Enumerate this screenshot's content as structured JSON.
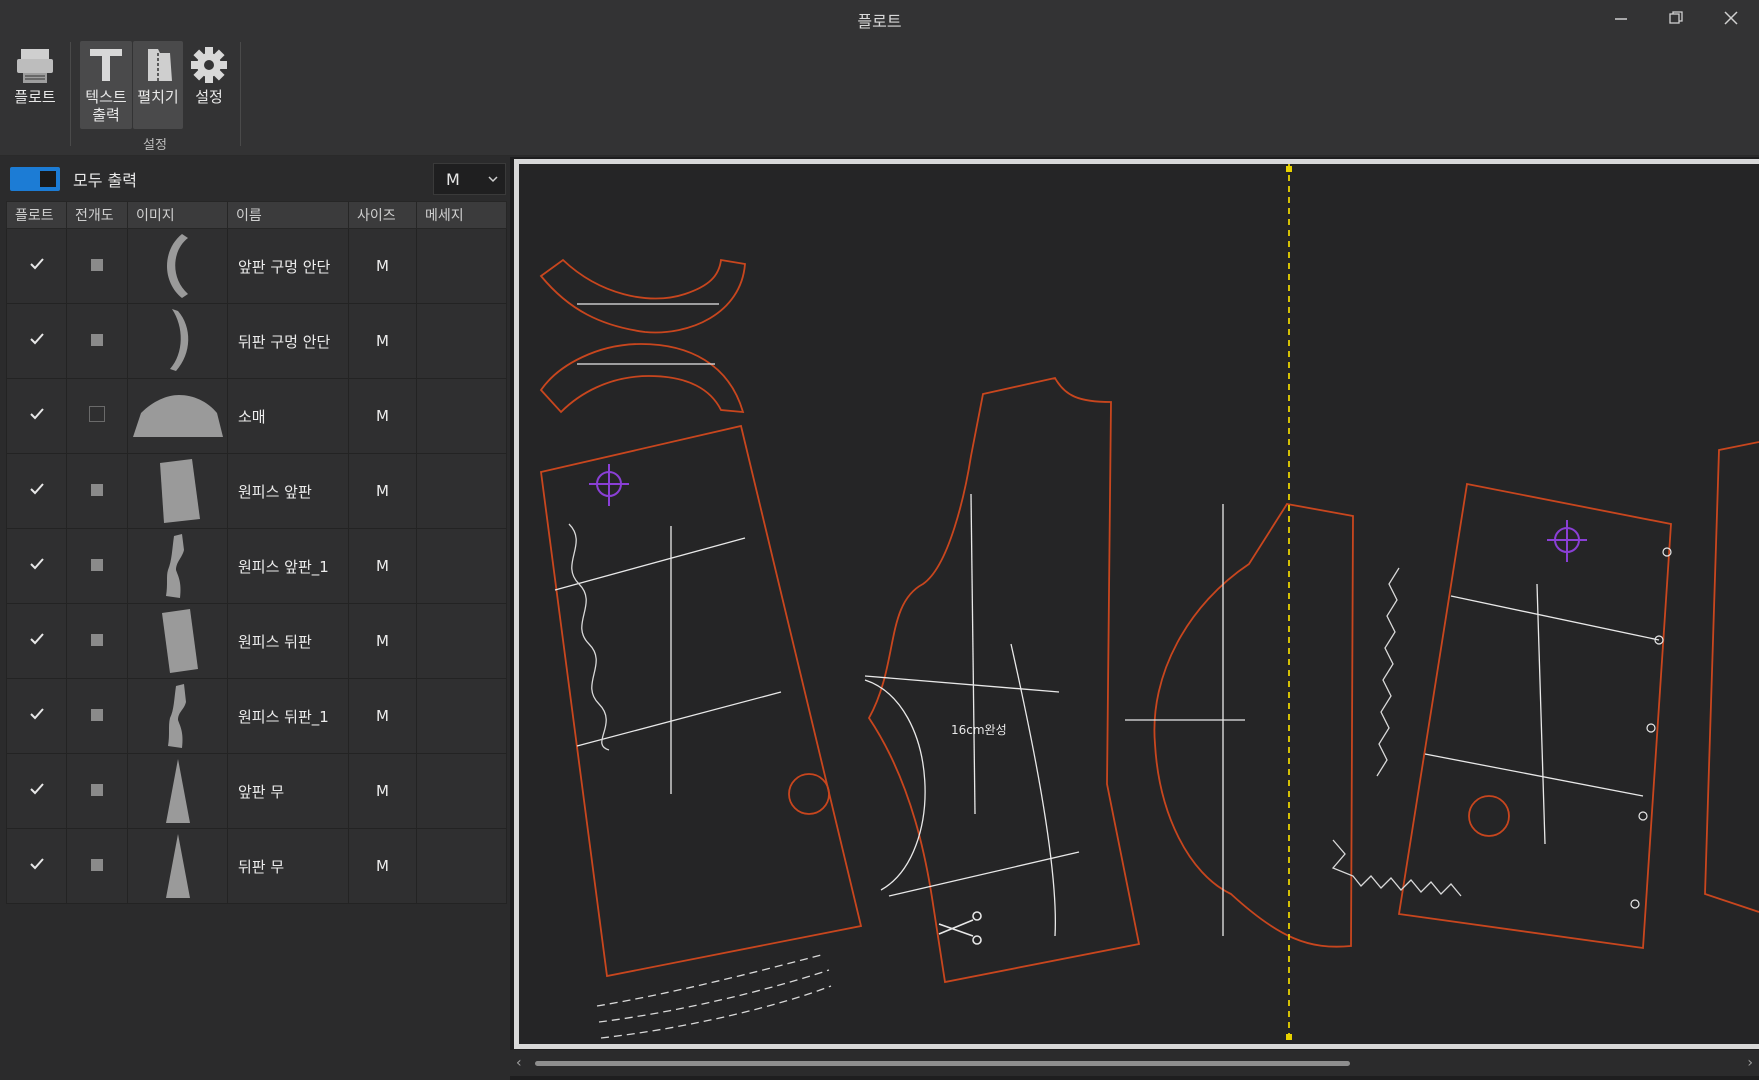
{
  "window": {
    "title": "플로트"
  },
  "ribbon": {
    "plot_label": "플로트",
    "text_output_label_line1": "텍스트",
    "text_output_label_line2": "출력",
    "unfold_label": "펼치기",
    "settings_label": "설정",
    "group_label": "설정"
  },
  "panel": {
    "toggle_label": "모두 출력",
    "size_selected": "M",
    "columns": [
      "플로트",
      "전개도",
      "이미지",
      "이름",
      "사이즈",
      "메세지"
    ],
    "rows": [
      {
        "plot": true,
        "unfold": true,
        "thumb": "front-neck-facing",
        "name": "앞판 구멍 안단",
        "size": "M",
        "message": ""
      },
      {
        "plot": true,
        "unfold": true,
        "thumb": "back-neck-facing",
        "name": "뒤판 구멍 안단",
        "size": "M",
        "message": ""
      },
      {
        "plot": true,
        "unfold": false,
        "thumb": "sleeve",
        "name": "소매",
        "size": "M",
        "message": ""
      },
      {
        "plot": true,
        "unfold": true,
        "thumb": "dress-front",
        "name": "원피스 앞판",
        "size": "M",
        "message": ""
      },
      {
        "plot": true,
        "unfold": true,
        "thumb": "dress-front-1",
        "name": "원피스 앞판_1",
        "size": "M",
        "message": ""
      },
      {
        "plot": true,
        "unfold": true,
        "thumb": "dress-back",
        "name": "원피스 뒤판",
        "size": "M",
        "message": ""
      },
      {
        "plot": true,
        "unfold": true,
        "thumb": "dress-back-1",
        "name": "원피스 뒤판_1",
        "size": "M",
        "message": ""
      },
      {
        "plot": true,
        "unfold": true,
        "thumb": "front-gore",
        "name": "앞판 무",
        "size": "M",
        "message": ""
      },
      {
        "plot": true,
        "unfold": true,
        "thumb": "back-gore",
        "name": "뒤판 무",
        "size": "M",
        "message": ""
      }
    ]
  },
  "canvas": {
    "annotation_finish": "16cm완성",
    "colors": {
      "outline": "#c8461e",
      "marker": "#8a3fd6",
      "cutline": "#e8d200",
      "grain": "#e8e8e8"
    }
  }
}
